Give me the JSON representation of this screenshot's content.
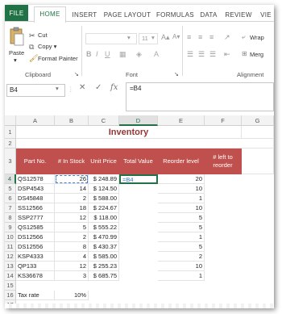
{
  "ribbon": {
    "tabs": [
      "FILE",
      "HOME",
      "INSERT",
      "PAGE LAYOUT",
      "FORMULAS",
      "DATA",
      "REVIEW",
      "VIE"
    ],
    "clipboard": {
      "paste": "Paste",
      "cut": "Cut",
      "copy": "Copy",
      "copy_arrow": "▾",
      "format_painter": "Format Painter",
      "label": "Clipboard"
    },
    "font": {
      "size": "11",
      "label": "Font",
      "bold": "B",
      "italic": "I",
      "underline": "U"
    },
    "alignment": {
      "wrap": "Wrap",
      "merge": "Merg",
      "label": "Alignment"
    }
  },
  "formula_bar": {
    "name_box": "B4",
    "cancel": "✕",
    "enter": "✓",
    "fx": "fx",
    "content": "=B4"
  },
  "columns": [
    "A",
    "B",
    "C",
    "D",
    "E",
    "F",
    "G"
  ],
  "rows": [
    "1",
    "2",
    "3",
    "4",
    "5",
    "6",
    "7",
    "8",
    "9",
    "10",
    "11",
    "12",
    "13",
    "14",
    "15",
    "16",
    "17"
  ],
  "sheet": {
    "title": "Inventory",
    "headers": [
      "Part No.",
      "# In Stock",
      "Unit Price",
      "Total Value",
      "Reorder level",
      "# left to reorder"
    ],
    "data": [
      [
        "QS12578",
        "26",
        "$ 248.89",
        "=B4",
        "20"
      ],
      [
        "DSP4543",
        "14",
        "$ 124.50",
        "",
        "10"
      ],
      [
        "DS45848",
        "2",
        "$ 588.00",
        "",
        "1"
      ],
      [
        "SS12566",
        "18",
        "$ 224.67",
        "",
        "10"
      ],
      [
        "SSP2777",
        "12",
        "$ 118.00",
        "",
        "5"
      ],
      [
        "QS12585",
        "5",
        "$ 555.22",
        "",
        "5"
      ],
      [
        "DS12566",
        "2",
        "$ 470.99",
        "",
        "1"
      ],
      [
        "DS12556",
        "8",
        "$ 430.37",
        "",
        "5"
      ],
      [
        "KSP4333",
        "4",
        "$ 585.00",
        "",
        "2"
      ],
      [
        "QP133",
        "12",
        "$ 255.23",
        "",
        "10"
      ],
      [
        "KS36678",
        "3",
        "$ 685.75",
        "",
        "1"
      ]
    ],
    "tax_label": "Tax rate",
    "tax_value": "10%"
  }
}
